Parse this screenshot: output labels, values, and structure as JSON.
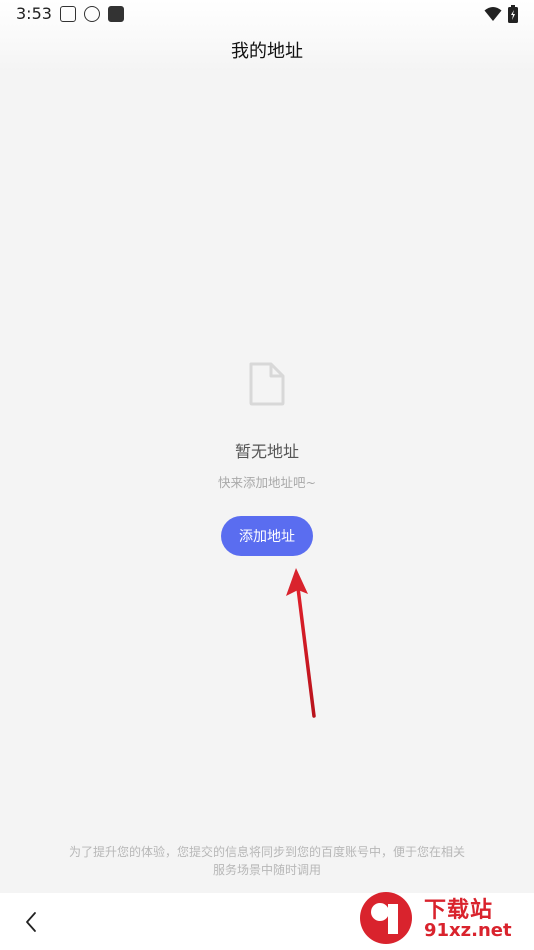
{
  "status_bar": {
    "time": "3:53",
    "icons": [
      "paw-icon",
      "weibo-icon",
      "a-icon"
    ],
    "right_icons": [
      "wifi-icon",
      "battery-icon"
    ]
  },
  "header": {
    "title": "我的地址"
  },
  "empty_state": {
    "icon": "document-icon",
    "title": "暂无地址",
    "subtitle": "快来添加地址吧~",
    "button_label": "添加地址"
  },
  "footer": {
    "note_line1": "为了提升您的体验，您提交的信息将同步到您的百度账号中，便于您在相关",
    "note_line2": "服务场景中随时调用"
  },
  "nav": {
    "back_icon": "chevron-left-icon"
  },
  "watermark": {
    "cn": "下载站",
    "en": "91xz.net"
  },
  "colors": {
    "accent": "#5a6df0",
    "background": "#f4f4f4",
    "arrow": "#d9232d"
  }
}
